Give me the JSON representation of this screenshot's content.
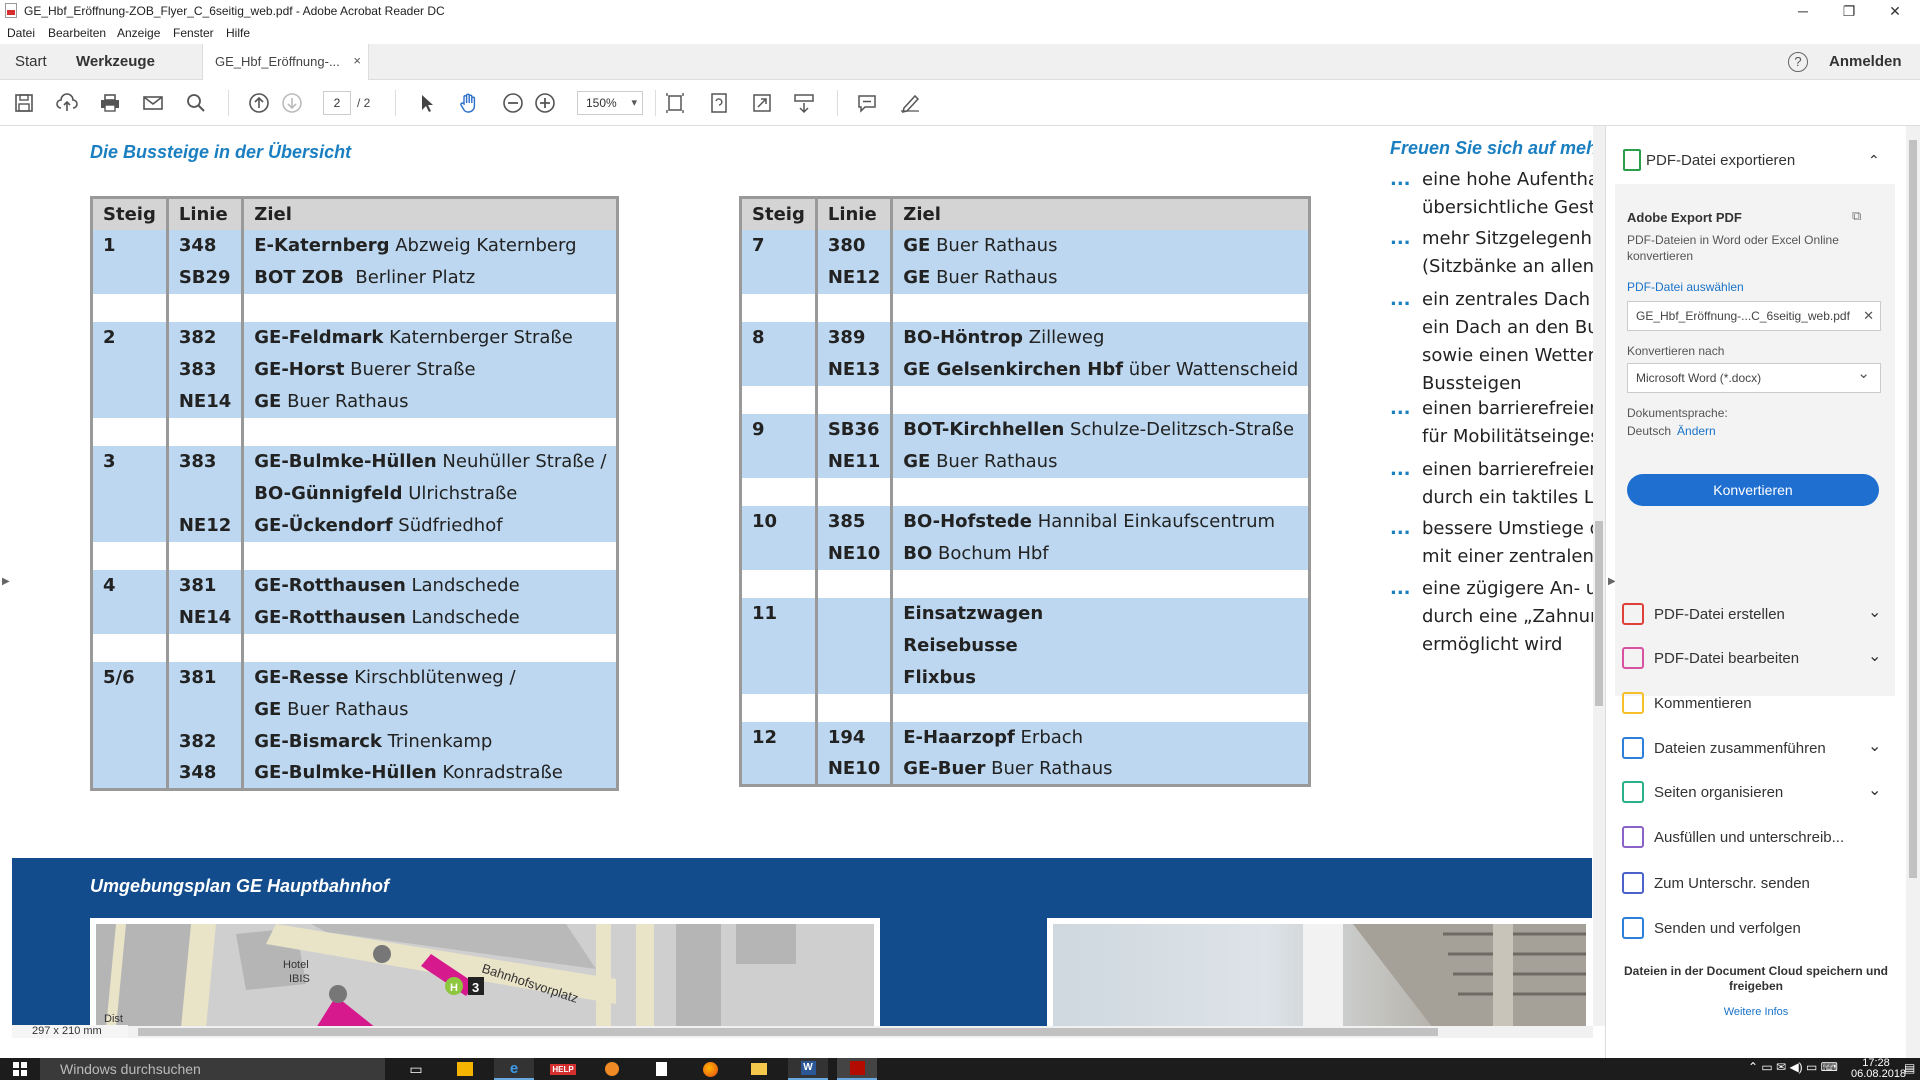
{
  "window": {
    "title": "GE_Hbf_Eröffnung-ZOB_Flyer_C_6seitig_web.pdf - Adobe Acrobat Reader DC",
    "minimize": "─",
    "maximize": "❐",
    "close": "✕"
  },
  "menu": [
    "Datei",
    "Bearbeiten",
    "Anzeige",
    "Fenster",
    "Hilfe"
  ],
  "tabs": {
    "start": "Start",
    "tools": "Werkzeuge",
    "doc_tab": "GE_Hbf_Eröffnung-...",
    "doc_tab_close": "×",
    "help": "?",
    "sign_in": "Anmelden"
  },
  "toolbar": {
    "page_current": "2",
    "page_total": "/ 2",
    "zoom": "150%"
  },
  "document": {
    "left_heading": "Die Bussteige in der Übersicht",
    "right_heading": "Freuen Sie sich auf meh",
    "columns": {
      "steig": "Steig",
      "linie": "Linie",
      "ziel": "Ziel"
    },
    "table_left": [
      {
        "type": "data",
        "steig": "1",
        "linie": "348",
        "ziel_b": "E-Katernberg",
        "ziel": " Abzweig Katernberg"
      },
      {
        "type": "data",
        "steig": "",
        "linie": "SB29",
        "ziel_b": "BOT ZOB",
        "ziel": "  Berliner Platz"
      },
      {
        "type": "gap"
      },
      {
        "type": "data",
        "steig": "2",
        "linie": "382",
        "ziel_b": "GE-Feldmark",
        "ziel": " Katernberger Straße"
      },
      {
        "type": "data",
        "steig": "",
        "linie": "383",
        "ziel_b": "GE-Horst",
        "ziel": " Buerer Straße"
      },
      {
        "type": "data",
        "steig": "",
        "linie": "NE14",
        "ziel_b": "GE",
        "ziel": " Buer Rathaus"
      },
      {
        "type": "gap"
      },
      {
        "type": "data",
        "steig": "3",
        "linie": "383",
        "ziel_b": "GE-Bulmke-Hüllen",
        "ziel": " Neuhüller Straße /"
      },
      {
        "type": "data",
        "steig": "",
        "linie": "",
        "ziel_b": "BO-Günnigfeld",
        "ziel": " Ulrichstraße"
      },
      {
        "type": "data",
        "steig": "",
        "linie": "NE12",
        "ziel_b": "GE-Ückendorf",
        "ziel": " Südfriedhof"
      },
      {
        "type": "gap"
      },
      {
        "type": "data",
        "steig": "4",
        "linie": "381",
        "ziel_b": "GE-Rotthausen",
        "ziel": " Landschede"
      },
      {
        "type": "data",
        "steig": "",
        "linie": "NE14",
        "ziel_b": "GE-Rotthausen",
        "ziel": " Landschede"
      },
      {
        "type": "gap"
      },
      {
        "type": "data",
        "steig": "5/6",
        "linie": "381",
        "ziel_b": "GE-Resse",
        "ziel": " Kirschblütenweg /"
      },
      {
        "type": "data",
        "steig": "",
        "linie": "",
        "ziel_b": "GE",
        "ziel": " Buer Rathaus"
      },
      {
        "type": "data",
        "steig": "",
        "linie": "382",
        "ziel_b": "GE-Bismarck",
        "ziel": " Trinenkamp"
      },
      {
        "type": "data",
        "steig": "",
        "linie": "348",
        "ziel_b": "GE-Bulmke-Hüllen",
        "ziel": " Konradstraße"
      }
    ],
    "table_right": [
      {
        "type": "data",
        "steig": "7",
        "linie": "380",
        "ziel_b": "GE",
        "ziel": " Buer Rathaus"
      },
      {
        "type": "data",
        "steig": "",
        "linie": "NE12",
        "ziel_b": "GE",
        "ziel": " Buer Rathaus"
      },
      {
        "type": "gap"
      },
      {
        "type": "data",
        "steig": "8",
        "linie": "389",
        "ziel_b": "BO-Höntrop",
        "ziel": " Zilleweg"
      },
      {
        "type": "data",
        "steig": "",
        "linie": "NE13",
        "ziel_b": "GE Gelsenkirchen Hbf",
        "ziel": " über Wattenscheid"
      },
      {
        "type": "gap"
      },
      {
        "type": "data",
        "steig": "9",
        "linie": "SB36",
        "ziel_b": "BOT-Kirchhellen",
        "ziel": " Schulze-Delitzsch-Straße"
      },
      {
        "type": "data",
        "steig": "",
        "linie": "NE11",
        "ziel_b": "GE",
        "ziel": " Buer Rathaus"
      },
      {
        "type": "gap"
      },
      {
        "type": "data",
        "steig": "10",
        "linie": "385",
        "ziel_b": "BO-Hofstede",
        "ziel": " Hannibal Einkaufscentrum"
      },
      {
        "type": "data",
        "steig": "",
        "linie": "NE10",
        "ziel_b": "BO",
        "ziel": " Bochum Hbf"
      },
      {
        "type": "gap"
      },
      {
        "type": "data",
        "steig": "11",
        "linie": "",
        "ziel_b": "Einsatzwagen",
        "ziel": ""
      },
      {
        "type": "data",
        "steig": "",
        "linie": "",
        "ziel_b": "Reisebusse",
        "ziel": ""
      },
      {
        "type": "data",
        "steig": "",
        "linie": "",
        "ziel_b": "Flixbus",
        "ziel": ""
      },
      {
        "type": "gap"
      },
      {
        "type": "data",
        "steig": "12",
        "linie": "194",
        "ziel_b": "E-Haarzopf",
        "ziel": " Erbach"
      },
      {
        "type": "data",
        "steig": "",
        "linie": "NE10",
        "ziel_b": "GE-Buer",
        "ziel": " Buer Rathaus"
      }
    ],
    "bullets": [
      "eine hohe Aufenthal\nübersichtliche Gesta",
      "mehr Sitzgelegenhei\n(Sitzbänke an allen B",
      "ein zentrales Dach au\nein Dach an den Bus\nsowie einen Wetters\nBussteigen",
      "einen barrierefreien \nfür Mobilitätseingesc",
      "einen barrierefreien \ndurch ein taktiles Le",
      "bessere Umstiege du\nmit einer zentralen M",
      "eine zügigere An- un\ndurch eine „Zahnung\nermöglicht wird"
    ],
    "bullet_marker": "...",
    "map_heading": "Umgebungsplan GE Hauptbahnhof",
    "map_labels": {
      "hotel": "Hotel\nIBIS",
      "street": "Bahnhofsvorplatz",
      "stop": "3",
      "stop_h": "H",
      "frag": "Dist"
    }
  },
  "status": {
    "page_size": "297 x 210 mm"
  },
  "right_pane": {
    "export_title": "PDF-Datei exportieren",
    "adobe_export": "Adobe Export PDF",
    "description": "PDF-Dateien in Word oder Excel Online konvertieren",
    "select_file": "PDF-Datei auswählen",
    "file_name": "GE_Hbf_Eröffnung-...C_6seitig_web.pdf",
    "convert_to_label": "Konvertieren nach",
    "convert_to_value": "Microsoft Word (*.docx)",
    "doc_language_label": "Dokumentsprache:",
    "doc_language": "Deutsch",
    "change": "Ändern",
    "convert_button": "Konvertieren",
    "tools": [
      {
        "label": "PDF-Datei erstellen",
        "chevron": "⌄",
        "color": "#e0403a"
      },
      {
        "label": "PDF-Datei bearbeiten",
        "chevron": "⌄",
        "color": "#d952a0"
      },
      {
        "label": "Kommentieren",
        "chevron": "",
        "color": "#f5c02a"
      },
      {
        "label": "Dateien zusammenführen",
        "chevron": "⌄",
        "color": "#2d7fd8"
      },
      {
        "label": "Seiten organisieren",
        "chevron": "⌄",
        "color": "#2bb08a"
      },
      {
        "label": "Ausfüllen und unterschreib...",
        "chevron": "",
        "color": "#8a63c9"
      },
      {
        "label": "Zum Unterschr. senden",
        "chevron": "",
        "color": "#4a62c9"
      },
      {
        "label": "Senden und verfolgen",
        "chevron": "",
        "color": "#2d7fd8"
      }
    ],
    "footer": "Dateien in der Document Cloud speichern und freigeben",
    "footer_link": "Weitere Infos"
  },
  "taskbar": {
    "search_placeholder": "Windows durchsuchen",
    "time": "17:28",
    "date": "06.08.2018"
  }
}
